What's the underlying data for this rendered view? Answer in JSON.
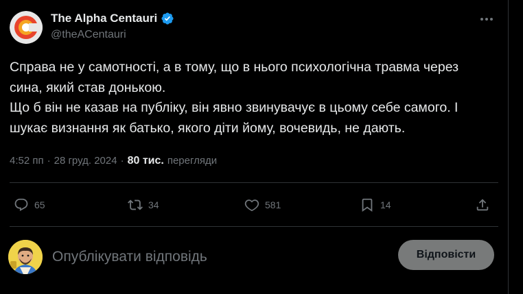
{
  "author": {
    "display_name": "The Alpha Centauri",
    "handle": "@theACentauri"
  },
  "tweet": {
    "lines": [
      "Справа не у самотності, а в тому, що в нього психологічна травма через",
      "сина, який став донькою.",
      "Що б він не казав на публіку, він явно звинувачує в цьому себе самого. І",
      "шукає визнання як батько, якого діти йому, вочевидь, не дають."
    ],
    "time": "4:52 пп",
    "separator": "·",
    "date": "28 груд. 2024",
    "views_count": "80 тис.",
    "views_label": "перегляди"
  },
  "actions": {
    "replies": "65",
    "reposts": "34",
    "likes": "581",
    "bookmarks": "14"
  },
  "reply": {
    "placeholder": "Опублікувати відповідь",
    "button_label": "Відповісти"
  },
  "colors": {
    "background": "#000000",
    "text": "#e7e9ea",
    "muted": "#71767b",
    "verified": "#1d9bf0",
    "divider": "#2f3336",
    "reply_button": "#787a7a"
  },
  "icons": {
    "verified": "verified-badge-icon",
    "more": "more-dots-icon",
    "reply": "reply-bubble-icon",
    "repost": "repost-icon",
    "like": "heart-icon",
    "bookmark": "bookmark-icon",
    "share": "share-icon"
  }
}
